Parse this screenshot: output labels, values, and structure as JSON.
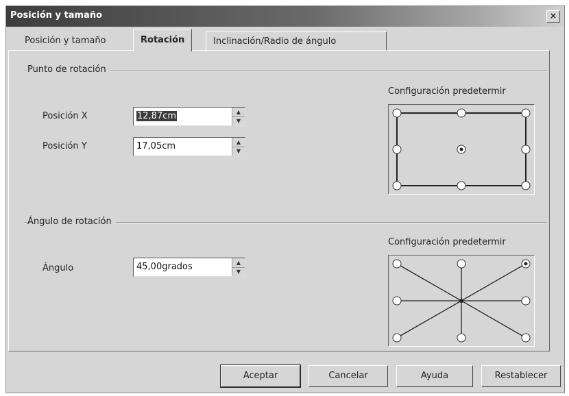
{
  "window": {
    "title": "Posición y tamaño",
    "close_glyph": "×"
  },
  "tabs": [
    {
      "label": "Posición y tamaño"
    },
    {
      "label": "Rotación"
    },
    {
      "label": "Inclinación/Radio de ángulo"
    }
  ],
  "rotation_point": {
    "group_label": "Punto de rotación",
    "position_x": {
      "label": "Posición X",
      "value": "12,87cm"
    },
    "position_y": {
      "label": "Posición Y",
      "value": "17,05cm"
    },
    "preset_label": "Configuración predetermir",
    "selected_point": "center"
  },
  "rotation_angle": {
    "group_label": "Ángulo de rotación",
    "angle": {
      "label": "Ángulo",
      "value": "45,00grados"
    },
    "preset_label": "Configuración predetermir",
    "selected_direction": "top-right"
  },
  "buttons": {
    "ok": "Aceptar",
    "cancel": "Cancelar",
    "help": "Ayuda",
    "reset": "Restablecer"
  },
  "colors": {
    "title_bar": "#3d3d3d",
    "dialog_bg": "#d6d6d6",
    "selection": "#3b3b3b"
  }
}
